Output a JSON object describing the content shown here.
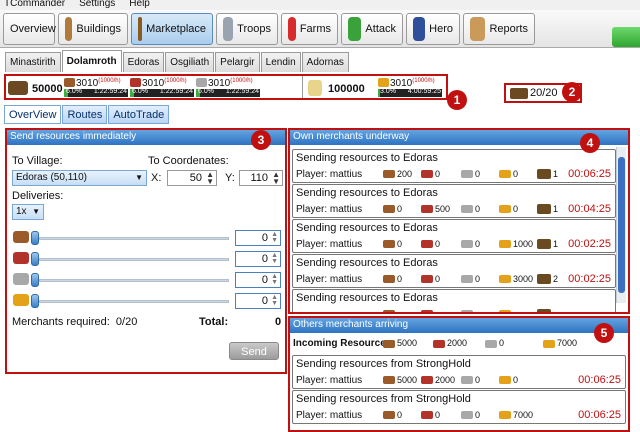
{
  "menubar": [
    "TCommander",
    "Settings",
    "Help"
  ],
  "nav": [
    {
      "label": "Overview",
      "icon": "overview-icon"
    },
    {
      "label": "Buildings",
      "icon": "buildings-icon"
    },
    {
      "label": "Marketplace",
      "icon": "marketplace-icon",
      "active": true
    },
    {
      "label": "Troops",
      "icon": "troops-icon"
    },
    {
      "label": "Farms",
      "icon": "farms-icon"
    },
    {
      "label": "Attack",
      "icon": "attack-icon"
    },
    {
      "label": "Hero",
      "icon": "hero-icon"
    },
    {
      "label": "Reports",
      "icon": "reports-icon"
    }
  ],
  "villages": [
    "Minastirith",
    "Dolamroth",
    "Edoras",
    "Osgiliath",
    "Pelargir",
    "Lendin",
    "Adornas"
  ],
  "active_village": "Dolamroth",
  "resources": {
    "warehouse_capacity": "50000",
    "wood": {
      "amount": "3010",
      "rate": "(1000/h)",
      "pct": "6.0%",
      "time": "1:22:59:24",
      "fill": 0.06
    },
    "clay": {
      "amount": "3010",
      "rate": "(1000/h)",
      "pct": "6.0%",
      "time": "1:22:59:24",
      "fill": 0.06
    },
    "iron": {
      "amount": "3010",
      "rate": "(1000/h)",
      "pct": "6.0%",
      "time": "1:22:59:24",
      "fill": 0.06
    },
    "granary_capacity": "100000",
    "crop": {
      "amount": "3010",
      "rate": "(1000/h)",
      "pct": "3.0%",
      "time": "4:00:59:25",
      "fill": 0.03
    }
  },
  "merchants_top": "20/20",
  "callouts": [
    "1",
    "2",
    "3",
    "4",
    "5"
  ],
  "subtabs": [
    "OverView",
    "Routes",
    "AutoTrade"
  ],
  "send": {
    "title": "Send resources immediately",
    "to_village_label": "To Village:",
    "to_village_value": "Edoras (50,110)",
    "to_coords_label": "To Coordenates:",
    "x_label": "X:",
    "x_value": "50",
    "y_label": "Y:",
    "y_value": "110",
    "deliveries_label": "Deliveries:",
    "deliveries_value": "1x",
    "sliders": [
      {
        "icon": "wood-icon",
        "value": "0"
      },
      {
        "icon": "clay-icon",
        "value": "0"
      },
      {
        "icon": "iron-icon",
        "value": "0"
      },
      {
        "icon": "crop-icon",
        "value": "0"
      }
    ],
    "merchants_required": "Merchants required:  0/20",
    "total_label": "Total:",
    "total_value": "0",
    "send_button": "Send"
  },
  "own": {
    "title": "Own merchants underway",
    "rows": [
      {
        "title": "Sending resources to Edoras",
        "player": "Player: mattius",
        "wood": "200",
        "clay": "0",
        "iron": "0",
        "crop": "0",
        "merchants": "1",
        "time": "00:06:25"
      },
      {
        "title": "Sending resources to Edoras",
        "player": "Player: mattius",
        "wood": "0",
        "clay": "500",
        "iron": "0",
        "crop": "0",
        "merchants": "1",
        "time": "00:04:25"
      },
      {
        "title": "Sending resources to Edoras",
        "player": "Player: mattius",
        "wood": "0",
        "clay": "0",
        "iron": "0",
        "crop": "1000",
        "merchants": "1",
        "time": "00:02:25"
      },
      {
        "title": "Sending resources to Edoras",
        "player": "Player: mattius",
        "wood": "0",
        "clay": "0",
        "iron": "0",
        "crop": "3000",
        "merchants": "2",
        "time": "00:02:25"
      },
      {
        "title": "Sending resources to Edoras",
        "player": "",
        "wood": "",
        "clay": "",
        "iron": "",
        "crop": "",
        "merchants": "",
        "time": ""
      }
    ]
  },
  "others": {
    "title": "Others merchants arriving",
    "incoming_label": "Incoming Resources:",
    "incoming": {
      "wood": "5000",
      "clay": "2000",
      "iron": "0",
      "crop": "7000"
    },
    "rows": [
      {
        "title": "Sending resources from StrongHold",
        "player": "Player: mattius",
        "wood": "5000",
        "clay": "2000",
        "iron": "0",
        "crop": "0",
        "time": "00:06:25"
      },
      {
        "title": "Sending resources from StrongHold",
        "player": "Player: mattius",
        "wood": "0",
        "clay": "0",
        "iron": "0",
        "crop": "7000",
        "time": "00:06:25"
      }
    ]
  }
}
